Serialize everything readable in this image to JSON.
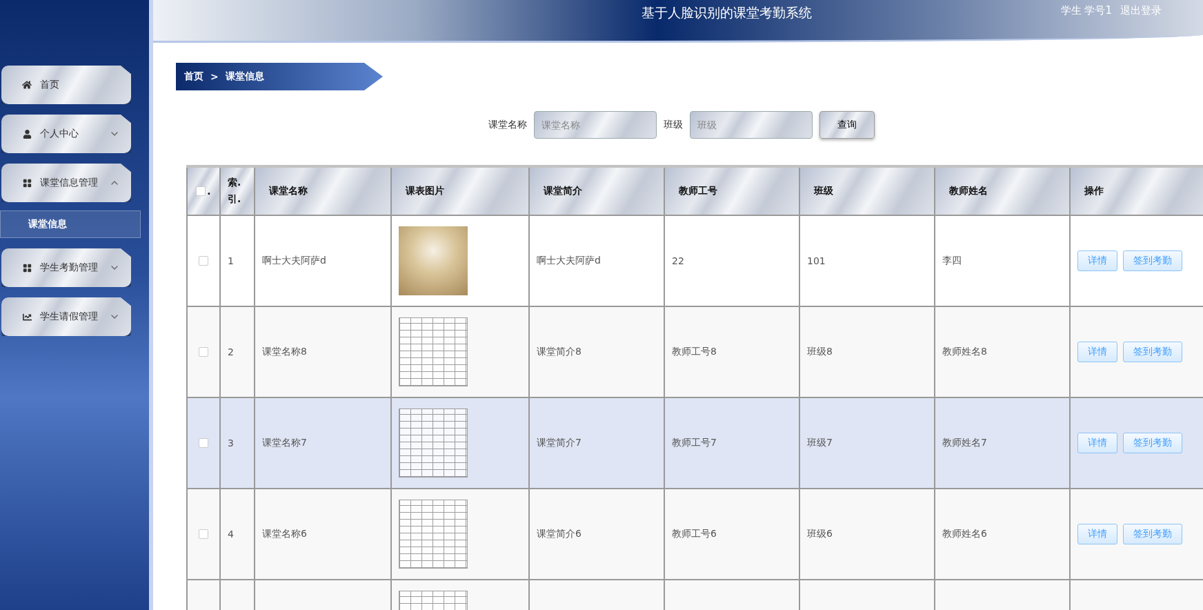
{
  "header": {
    "title": "基于人脸识别的课堂考勤系统",
    "user": "学生 学号1",
    "logout": "退出登录"
  },
  "sidebar": {
    "items": [
      {
        "label": "首页",
        "kind": "home"
      },
      {
        "label": "个人中心",
        "kind": "person",
        "expanded": false
      },
      {
        "label": "课堂信息管理",
        "kind": "grid",
        "expanded": true,
        "children": [
          {
            "label": "课堂信息",
            "selected": true
          }
        ]
      },
      {
        "label": "学生考勤管理",
        "kind": "grid",
        "expanded": false
      },
      {
        "label": "学生请假管理",
        "kind": "chart",
        "expanded": false
      }
    ]
  },
  "breadcrumb": {
    "items": [
      "首页",
      "课堂信息"
    ],
    "separator": ">"
  },
  "search": {
    "fields": [
      {
        "label": "课堂名称",
        "placeholder": "课堂名称"
      },
      {
        "label": "班级",
        "placeholder": "班级"
      }
    ],
    "button": "查询"
  },
  "table": {
    "select_all": {
      "checked": false,
      "suffix": "."
    },
    "columns": [
      "索.引.",
      "课堂名称",
      "课表图片",
      "课堂简介",
      "教师工号",
      "班级",
      "教师姓名",
      "操作"
    ],
    "rows": [
      {
        "checked": false,
        "selected": false,
        "index": "1",
        "name": "啊士大夫阿萨d",
        "kind": "photo",
        "intro": "啊士大夫阿萨d",
        "teacher_id": "22",
        "class": "101",
        "teacher_name": "李四",
        "actions": [
          "详情",
          "签到考勤"
        ]
      },
      {
        "checked": false,
        "selected": false,
        "index": "2",
        "name": "课堂名称8",
        "kind": "document",
        "intro": "课堂简介8",
        "teacher_id": "教师工号8",
        "class": "班级8",
        "teacher_name": "教师姓名8",
        "actions": [
          "详情",
          "签到考勤"
        ]
      },
      {
        "checked": false,
        "selected": true,
        "index": "3",
        "name": "课堂名称7",
        "kind": "document",
        "intro": "课堂简介7",
        "teacher_id": "教师工号7",
        "class": "班级7",
        "teacher_name": "教师姓名7",
        "actions": [
          "详情",
          "签到考勤"
        ]
      },
      {
        "checked": false,
        "selected": false,
        "index": "4",
        "name": "课堂名称6",
        "kind": "document",
        "intro": "课堂简介6",
        "teacher_id": "教师工号6",
        "class": "班级6",
        "teacher_name": "教师姓名6",
        "actions": [
          "详情",
          "签到考勤"
        ]
      },
      {
        "selected": false,
        "kind": "document"
      }
    ]
  }
}
